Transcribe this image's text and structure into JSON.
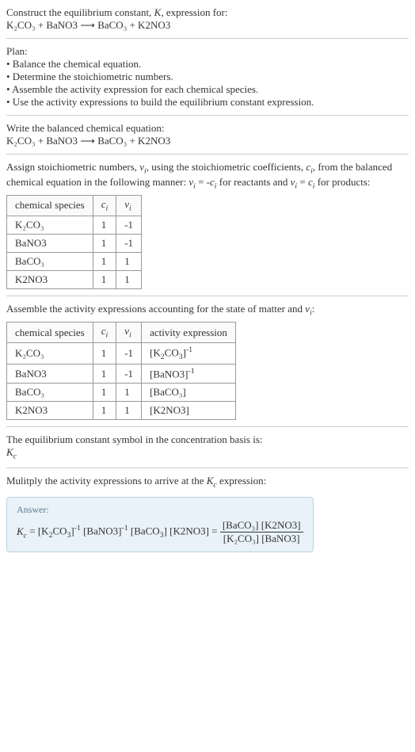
{
  "header": {
    "line1": "Construct the equilibrium constant, K, expression for:",
    "equation": "K₂CO₃ + BaNO3  ⟶  BaCO₃ + K2NO3"
  },
  "plan": {
    "title": "Plan:",
    "b1": "• Balance the chemical equation.",
    "b2": "• Determine the stoichiometric numbers.",
    "b3": "• Assemble the activity expression for each chemical species.",
    "b4": "• Use the activity expressions to build the equilibrium constant expression."
  },
  "balanced": {
    "title": "Write the balanced chemical equation:",
    "equation": "K₂CO₃ + BaNO3  ⟶  BaCO₃ + K2NO3"
  },
  "assign": {
    "text": "Assign stoichiometric numbers, νᵢ, using the stoichiometric coefficients, cᵢ, from the balanced chemical equation in the following manner: νᵢ = -cᵢ for reactants and νᵢ = cᵢ for products:",
    "table": {
      "h1": "chemical species",
      "h2": "cᵢ",
      "h3": "νᵢ",
      "rows": [
        {
          "sp": "K₂CO₃",
          "c": "1",
          "v": "-1"
        },
        {
          "sp": "BaNO3",
          "c": "1",
          "v": "-1"
        },
        {
          "sp": "BaCO₃",
          "c": "1",
          "v": "1"
        },
        {
          "sp": "K2NO3",
          "c": "1",
          "v": "1"
        }
      ]
    }
  },
  "assemble": {
    "text": "Assemble the activity expressions accounting for the state of matter and νᵢ:",
    "table": {
      "h1": "chemical species",
      "h2": "cᵢ",
      "h3": "νᵢ",
      "h4": "activity expression",
      "rows": [
        {
          "sp": "K₂CO₃",
          "c": "1",
          "v": "-1",
          "ae": "[K₂CO₃]⁻¹"
        },
        {
          "sp": "BaNO3",
          "c": "1",
          "v": "-1",
          "ae": "[BaNO3]⁻¹"
        },
        {
          "sp": "BaCO₃",
          "c": "1",
          "v": "1",
          "ae": "[BaCO₃]"
        },
        {
          "sp": "K2NO3",
          "c": "1",
          "v": "1",
          "ae": "[K2NO3]"
        }
      ]
    }
  },
  "symbol": {
    "line1": "The equilibrium constant symbol in the concentration basis is:",
    "line2": "K_c"
  },
  "multiply": {
    "text": "Mulitply the activity expressions to arrive at the K_c expression:"
  },
  "answer": {
    "label": "Answer:",
    "lhs": "K_c = [K₂CO₃]⁻¹ [BaNO3]⁻¹ [BaCO₃] [K2NO3] = ",
    "num": "[BaCO₃] [K2NO3]",
    "den": "[K₂CO₃] [BaNO3]"
  },
  "chart_data": {
    "type": "table",
    "tables": [
      {
        "title": "Stoichiometric numbers",
        "columns": [
          "chemical species",
          "c_i",
          "v_i"
        ],
        "rows": [
          [
            "K2CO3",
            1,
            -1
          ],
          [
            "BaNO3",
            1,
            -1
          ],
          [
            "BaCO3",
            1,
            1
          ],
          [
            "K2NO3",
            1,
            1
          ]
        ]
      },
      {
        "title": "Activity expressions",
        "columns": [
          "chemical species",
          "c_i",
          "v_i",
          "activity expression"
        ],
        "rows": [
          [
            "K2CO3",
            1,
            -1,
            "[K2CO3]^-1"
          ],
          [
            "BaNO3",
            1,
            -1,
            "[BaNO3]^-1"
          ],
          [
            "BaCO3",
            1,
            1,
            "[BaCO3]"
          ],
          [
            "K2NO3",
            1,
            1,
            "[K2NO3]"
          ]
        ]
      }
    ]
  }
}
